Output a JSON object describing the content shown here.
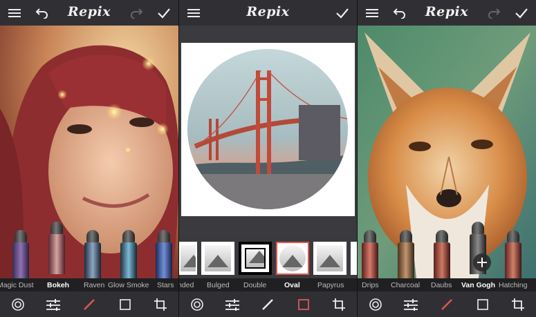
{
  "app": {
    "logo": "Repix"
  },
  "panels": [
    {
      "brushes": [
        "Magic Dust",
        "Bokeh",
        "Raven",
        "Glow Smoke",
        "Stars"
      ],
      "active": "Bokeh"
    },
    {
      "frames": [
        "nded",
        "Bulged",
        "Double",
        "Oval",
        "Papyrus"
      ],
      "active": "Oval"
    },
    {
      "brushes": [
        "Drips",
        "Charcoal",
        "Daubs",
        "Van Gogh",
        "Hatching"
      ],
      "active": "Van Gogh"
    }
  ],
  "colors": {
    "accent": "#e0574e",
    "bar": "#303034",
    "text": "#ffffff"
  },
  "icons": [
    "menu-icon",
    "undo-icon",
    "redo-icon",
    "check-icon",
    "circle-target-icon",
    "sliders-icon",
    "brush-icon",
    "square-crop-icon",
    "crop-icon",
    "add-icon"
  ]
}
